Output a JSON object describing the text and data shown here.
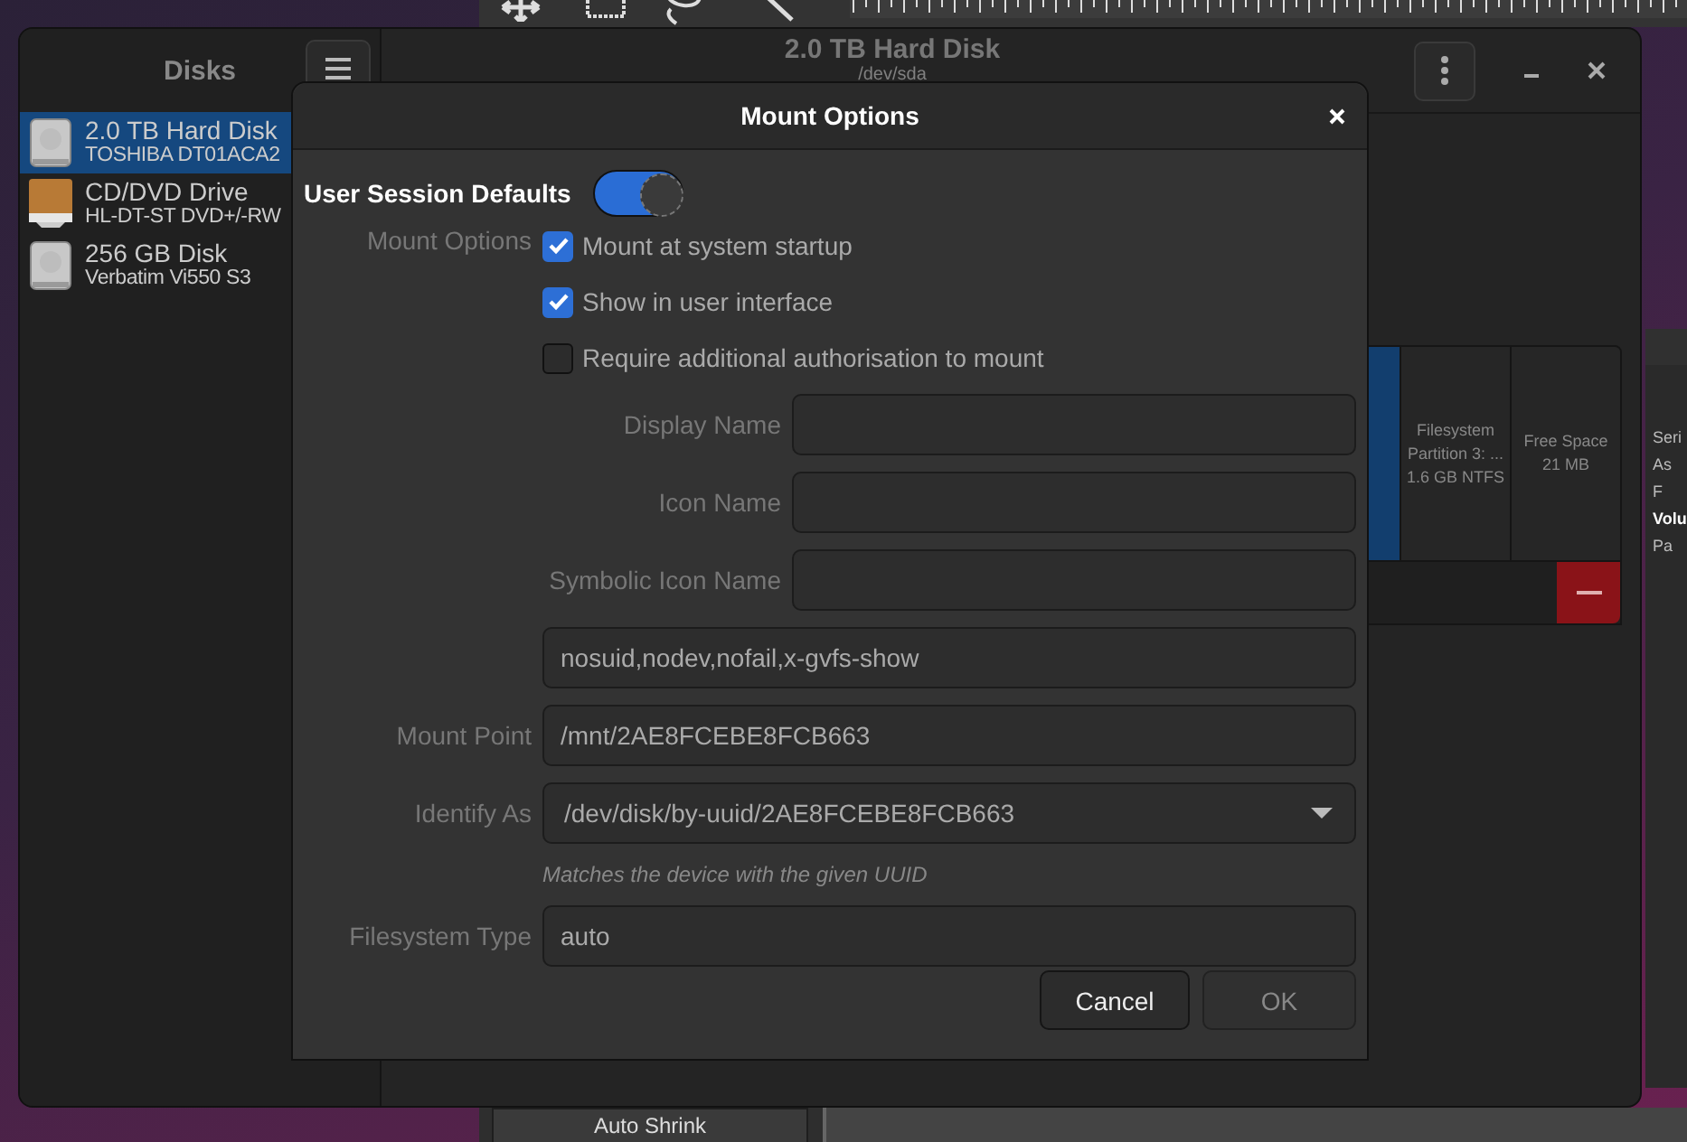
{
  "background_app": {
    "auto_shrink_button": "Auto Shrink"
  },
  "side_window": {
    "texts": [
      {
        "text": "Seri",
        "kind": "plain"
      },
      {
        "text": "As",
        "kind": "plain"
      },
      {
        "text": "F",
        "kind": "plain"
      },
      {
        "text": "Volu",
        "kind": "heading"
      },
      {
        "text": "Pa",
        "kind": "plain"
      }
    ]
  },
  "disks_window": {
    "sidebar_title": "Disks",
    "devices": [
      {
        "name": "2.0 TB Hard Disk",
        "model": "TOSHIBA DT01ACA2",
        "kind": "hdd",
        "selected": true
      },
      {
        "name": "CD/DVD Drive",
        "model": "HL-DT-ST DVD+/-RW",
        "kind": "optical",
        "selected": false
      },
      {
        "name": "256 GB Disk",
        "model": "Verbatim Vi550 S3",
        "kind": "hdd",
        "selected": false
      }
    ],
    "title": "2.0 TB Hard Disk",
    "subtitle": "/dev/sda",
    "partitions": [
      {
        "kind": "partition",
        "selected": true
      },
      {
        "kind": "partition",
        "selected": false,
        "lines": [
          "Filesystem",
          "Partition 3: ...",
          "1.6 GB NTFS"
        ]
      },
      {
        "kind": "free",
        "selected": false,
        "lines": [
          "Free Space",
          "21 MB"
        ]
      }
    ]
  },
  "dialog": {
    "title": "Mount Options",
    "user_session_defaults": {
      "label": "User Session Defaults",
      "on": true
    },
    "section_label": "Mount Options",
    "checkboxes": [
      {
        "label": "Mount at system startup",
        "checked": true
      },
      {
        "label": "Show in user interface",
        "checked": true
      },
      {
        "label": "Require additional authorisation to mount",
        "checked": false
      }
    ],
    "name_fields": [
      {
        "label": "Display Name"
      },
      {
        "label": "Icon Name"
      },
      {
        "label": "Symbolic Icon Name"
      }
    ],
    "options_value": "nosuid,nodev,nofail,x-gvfs-show",
    "mount_point": {
      "label": "Mount Point",
      "value": "/mnt/2AE8FCEBE8FCB663"
    },
    "identify_as": {
      "label": "Identify As",
      "value": "/dev/disk/by-uuid/2AE8FCEBE8FCB663",
      "hint": "Matches the device with the given UUID"
    },
    "filesystem_type": {
      "label": "Filesystem Type",
      "value": "auto"
    },
    "buttons": [
      {
        "label": "Cancel",
        "disabled": false
      },
      {
        "label": "OK",
        "disabled": true
      }
    ]
  }
}
